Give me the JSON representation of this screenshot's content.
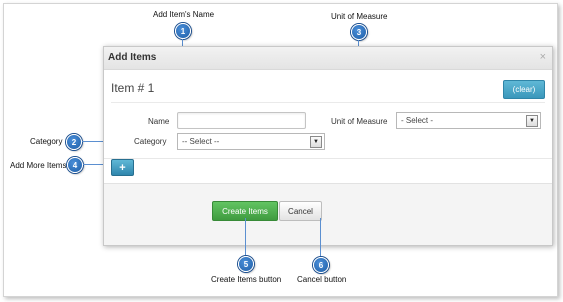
{
  "callouts": {
    "c1": {
      "number": "1",
      "label": "Add Item's Name"
    },
    "c2": {
      "number": "2",
      "label": "Category"
    },
    "c3": {
      "number": "3",
      "label": "Unit of Measure"
    },
    "c4": {
      "number": "4",
      "label": "Add More Items"
    },
    "c5": {
      "number": "5",
      "label": "Create Items button"
    },
    "c6": {
      "number": "6",
      "label": "Cancel button"
    }
  },
  "modal": {
    "title": "Add Items",
    "close_icon": "×",
    "item_title": "Item # 1",
    "clear_label": "(clear)",
    "name_label": "Name",
    "name_value": "",
    "unit_label": "Unit of Measure",
    "unit_value": "- Select -",
    "category_label": "Category",
    "category_value": "-- Select --",
    "add_more_label": "+",
    "create_label": "Create Items",
    "cancel_label": "Cancel"
  },
  "icons": {
    "close": "close-icon",
    "add": "plus-icon",
    "dropdown": "dropdown-arrow-icon"
  },
  "colors": {
    "callout_badge": "#1f5fa8",
    "callout_line": "#5b8fd0",
    "clear_button": "#3a97bb",
    "add_button": "#2f86ad",
    "create_button": "#3f9b3f"
  }
}
